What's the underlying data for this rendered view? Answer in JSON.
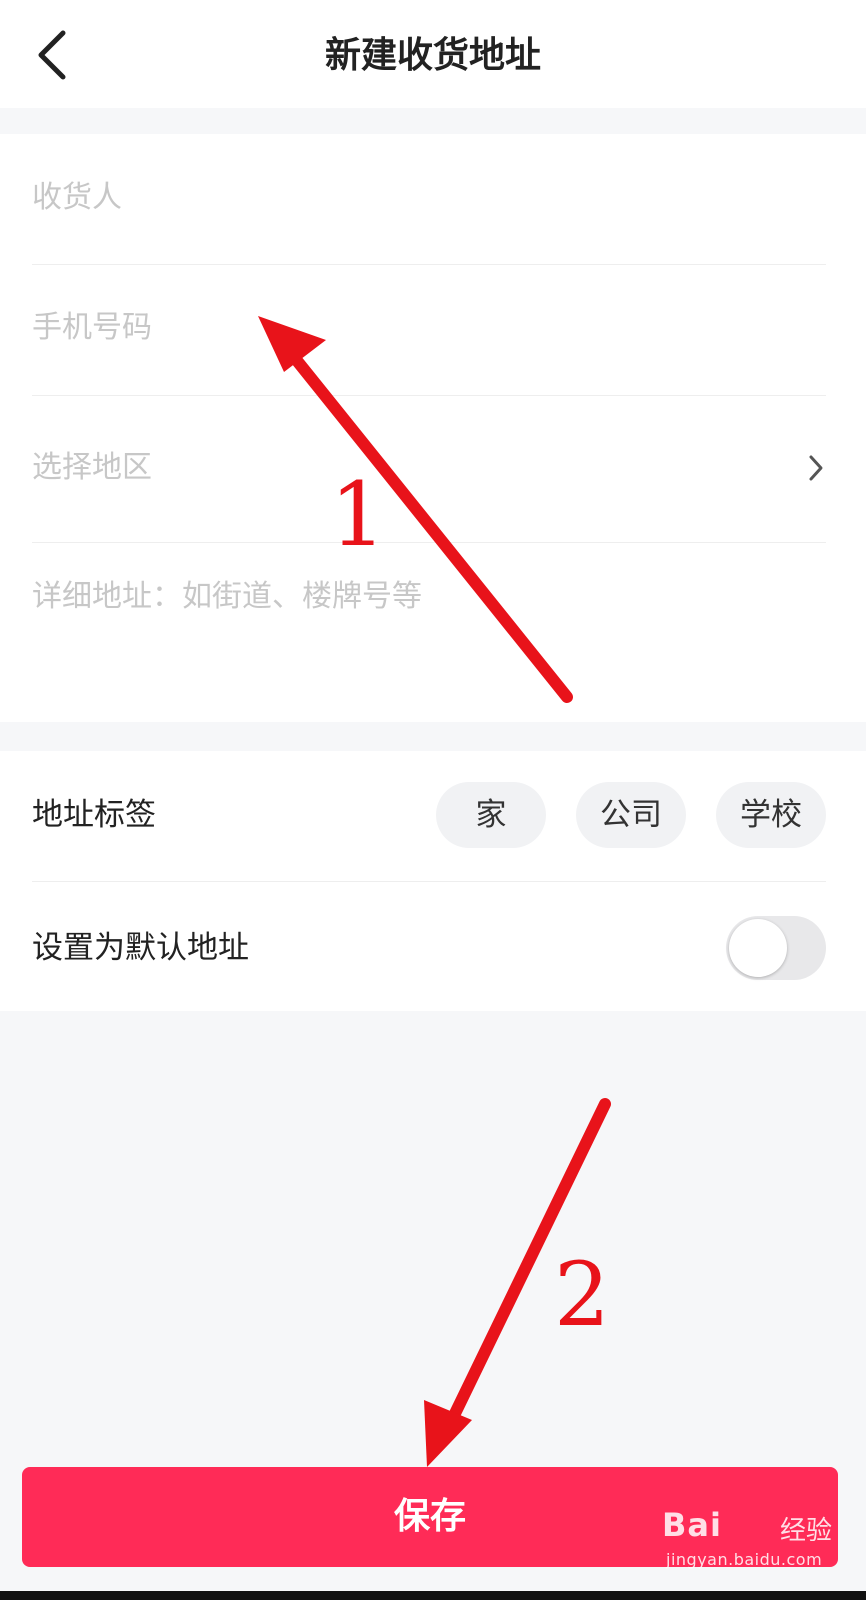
{
  "header": {
    "title": "新建收货地址",
    "back_icon": "chevron-left-icon"
  },
  "form": {
    "recipient_placeholder": "收货人",
    "phone_placeholder": "手机号码",
    "region_placeholder": "选择地区",
    "region_icon": "chevron-right-icon",
    "detail_placeholder": "详细地址：如街道、楼牌号等"
  },
  "options": {
    "tag_label": "地址标签",
    "tags": [
      "家",
      "公司",
      "学校"
    ],
    "default_label": "设置为默认地址",
    "default_enabled": false
  },
  "actions": {
    "save_label": "保存"
  },
  "annotations": {
    "step1": "1",
    "step2": "2",
    "arrow_color": "#e8131a"
  },
  "watermark": {
    "brand": "Bai",
    "brand2": "经验",
    "url": "jingyan.baidu.com"
  },
  "colors": {
    "accent": "#ff2b57",
    "placeholder": "#c7c7c7",
    "background": "#f6f7f9"
  }
}
